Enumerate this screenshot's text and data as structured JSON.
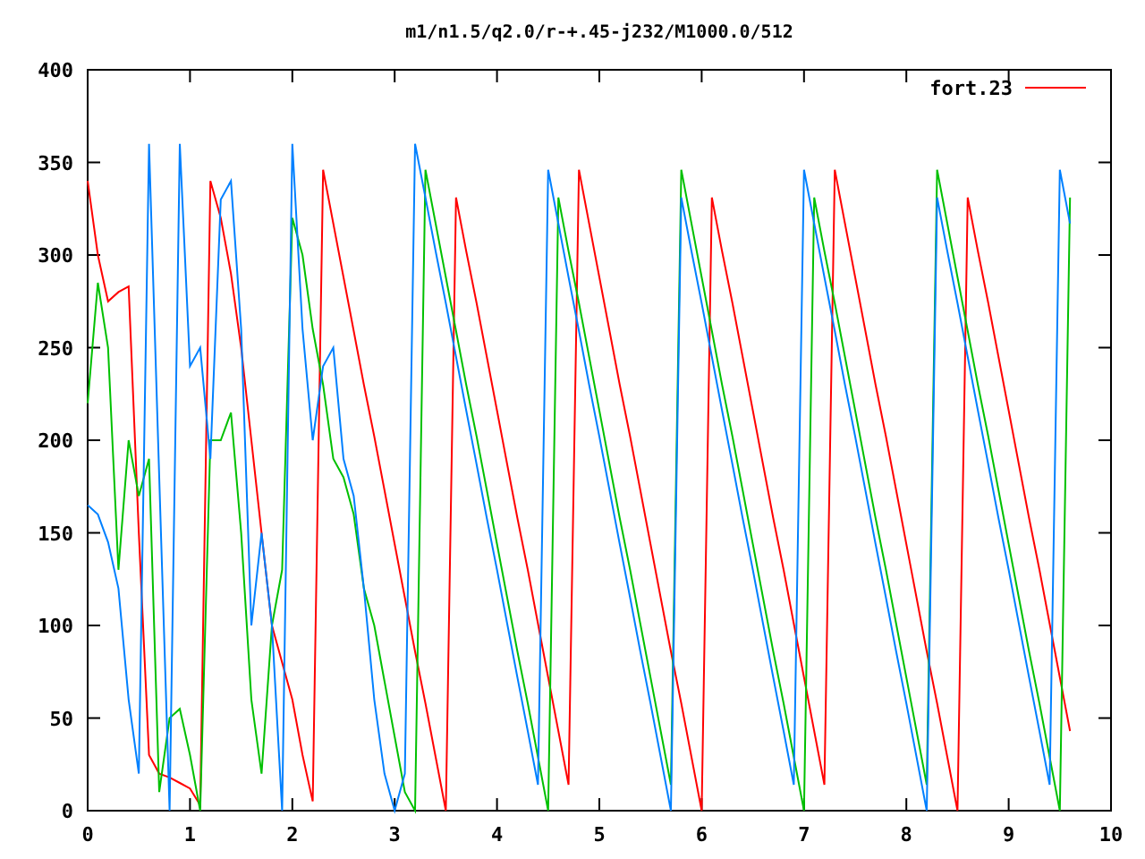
{
  "chart_data": {
    "type": "line",
    "title": "m1/n1.5/q2.0/r-+.45-j232/M1000.0/512",
    "x": [
      0,
      0.1,
      0.2,
      0.3,
      0.4,
      0.5,
      0.6,
      0.7,
      0.8,
      0.9,
      1,
      1.1,
      1.2,
      1.3,
      1.4,
      1.5,
      1.6,
      1.7,
      1.8,
      1.9,
      2,
      2.1,
      2.2,
      2.3,
      2.4,
      2.5,
      2.6,
      2.7,
      2.8,
      2.9,
      3,
      3.1,
      3.2,
      3.3,
      3.4,
      3.5,
      3.6,
      3.7,
      3.8,
      3.9,
      4,
      4.1,
      4.2,
      4.3,
      4.4,
      4.5,
      4.6,
      4.7,
      4.8,
      4.9,
      5,
      5.1,
      5.2,
      5.3,
      5.4,
      5.5,
      5.6,
      5.7,
      5.8,
      5.9,
      6,
      6.1,
      6.2,
      6.3,
      6.4,
      6.5,
      6.6,
      6.7,
      6.8,
      6.9,
      7,
      7.1,
      7.2,
      7.3,
      7.4,
      7.5,
      7.6,
      7.7,
      7.8,
      7.9,
      8,
      8.1,
      8.2,
      8.3,
      8.4,
      8.5,
      8.6,
      8.7,
      8.8,
      8.9,
      9,
      9.1,
      9.2,
      9.3,
      9.4,
      9.5,
      9.6
    ],
    "series": [
      {
        "name": "fort.23",
        "color": "#ff0000",
        "values": [
          340,
          300,
          275,
          280,
          283,
          150,
          30,
          20,
          18,
          15,
          12,
          3,
          340,
          320,
          290,
          250,
          200,
          150,
          100,
          80,
          60,
          30,
          5,
          346,
          317,
          288,
          259,
          230,
          202,
          173,
          144,
          115,
          86,
          58,
          29,
          0,
          331,
          302,
          274,
          245,
          216,
          187,
          158,
          130,
          101,
          72,
          43,
          14,
          346,
          317,
          288,
          259,
          230,
          202,
          173,
          144,
          115,
          86,
          58,
          29,
          0,
          331,
          302,
          274,
          245,
          216,
          187,
          158,
          130,
          101,
          72,
          43,
          14,
          346,
          317,
          288,
          259,
          230,
          202,
          173,
          144,
          115,
          86,
          58,
          29,
          0,
          331,
          302,
          274,
          245,
          216,
          187,
          158,
          130,
          101,
          72,
          43
        ]
      },
      {
        "color": "#00c000",
        "values": [
          220,
          285,
          250,
          130,
          200,
          170,
          190,
          10,
          50,
          55,
          30,
          0,
          200,
          200,
          215,
          150,
          60,
          20,
          100,
          130,
          320,
          300,
          260,
          230,
          190,
          180,
          160,
          120,
          100,
          70,
          40,
          10,
          0,
          346,
          317,
          288,
          259,
          230,
          202,
          173,
          144,
          115,
          86,
          58,
          29,
          0,
          331,
          302,
          274,
          245,
          216,
          187,
          158,
          130,
          101,
          72,
          43,
          14,
          346,
          317,
          288,
          259,
          230,
          202,
          173,
          144,
          115,
          86,
          58,
          29,
          0,
          331,
          302,
          274,
          245,
          216,
          187,
          158,
          130,
          101,
          72,
          43,
          14,
          346,
          317,
          288,
          259,
          230,
          202,
          173,
          144,
          115,
          86,
          58,
          29,
          0,
          331
        ]
      },
      {
        "color": "#0080ff",
        "values": [
          165,
          160,
          145,
          120,
          60,
          20,
          360,
          180,
          0,
          360,
          240,
          250,
          190,
          330,
          340,
          260,
          100,
          150,
          100,
          0,
          360,
          260,
          200,
          240,
          250,
          190,
          170,
          120,
          60,
          20,
          0,
          20,
          360,
          331,
          302,
          274,
          245,
          216,
          187,
          158,
          130,
          101,
          72,
          43,
          14,
          346,
          317,
          288,
          259,
          230,
          202,
          173,
          144,
          115,
          86,
          58,
          29,
          0,
          331,
          302,
          274,
          245,
          216,
          187,
          158,
          130,
          101,
          72,
          43,
          14,
          346,
          317,
          288,
          259,
          230,
          202,
          173,
          144,
          115,
          86,
          58,
          29,
          0,
          331,
          302,
          274,
          245,
          216,
          187,
          158,
          130,
          101,
          72,
          43,
          14,
          346,
          317
        ]
      }
    ],
    "xlim": [
      0,
      10
    ],
    "ylim": [
      0,
      400
    ],
    "xticks": [
      0,
      1,
      2,
      3,
      4,
      5,
      6,
      7,
      8,
      9,
      10
    ],
    "yticks": [
      0,
      50,
      100,
      150,
      200,
      250,
      300,
      350,
      400
    ]
  }
}
